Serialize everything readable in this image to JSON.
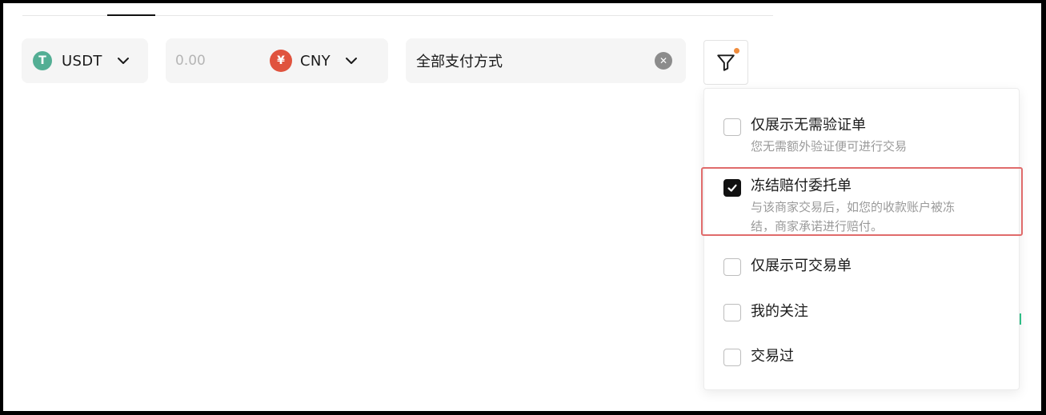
{
  "filters": {
    "coin": {
      "label": "USDT",
      "icon": "tether-icon",
      "icon_glyph": "T",
      "color": "#53ae94"
    },
    "amount": {
      "placeholder": "0.00",
      "value": ""
    },
    "fiat": {
      "label": "CNY",
      "icon": "yuan-icon",
      "icon_glyph": "¥",
      "color": "#e0533e"
    },
    "payment": {
      "label": "全部支付方式",
      "clear_glyph": "✕"
    }
  },
  "filter_button": {
    "icon": "filter-funnel-icon",
    "indicator_color": "#f08c3c"
  },
  "panel": {
    "options": [
      {
        "title": "仅展示无需验证单",
        "description": "您无需额外验证便可进行交易",
        "checked": false
      },
      {
        "title": "冻结赔付委托单",
        "description_line1": "与该商家交易后，如您的收款账户被冻",
        "description_line2": "结，商家承诺进行赔付。",
        "checked": true
      },
      {
        "title": "仅展示可交易单",
        "checked": false
      },
      {
        "title": "我的关注",
        "checked": false
      },
      {
        "title": "交易过",
        "checked": false
      }
    ]
  },
  "colors": {
    "highlight_border": "#e06b6b",
    "checkbox_checked": "#111111"
  }
}
